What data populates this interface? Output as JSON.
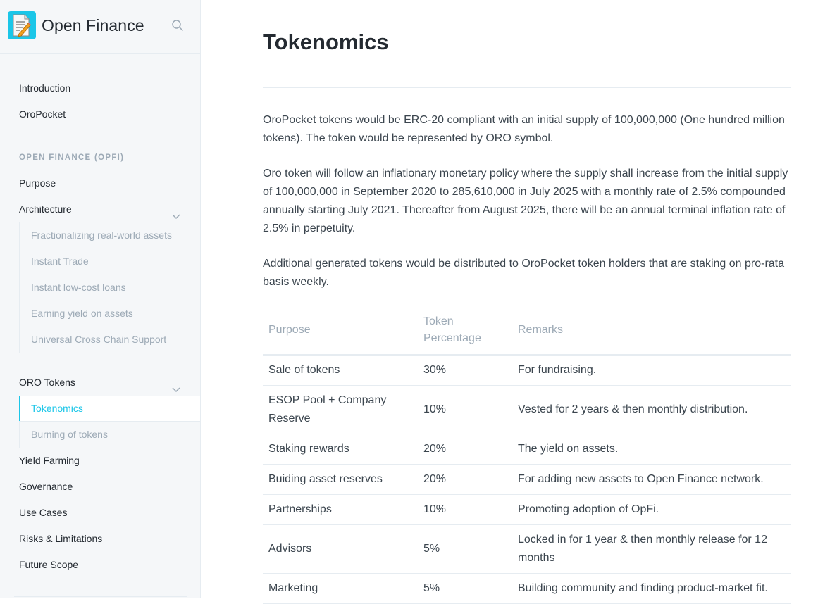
{
  "app": {
    "title": "Open Finance",
    "logo_icon": "memo-pencil-icon",
    "search_icon": "search-icon",
    "accent_color": "#1bc6e8"
  },
  "sidebar": {
    "top_items": [
      {
        "label": "Introduction"
      },
      {
        "label": "OroPocket"
      }
    ],
    "section_title": "OPEN FINANCE (OPFI)",
    "items": [
      {
        "label": "Purpose"
      },
      {
        "label": "Architecture",
        "expanded": true
      },
      {
        "label": "ORO Tokens",
        "expanded": true
      },
      {
        "label": "Yield Farming"
      },
      {
        "label": "Governance"
      },
      {
        "label": "Use Cases"
      },
      {
        "label": "Risks & Limitations"
      },
      {
        "label": "Future Scope"
      }
    ],
    "architecture_children": [
      {
        "label": "Fractionalizing real-world assets"
      },
      {
        "label": "Instant Trade"
      },
      {
        "label": "Instant low-cost loans"
      },
      {
        "label": "Earning yield on assets"
      },
      {
        "label": "Universal Cross Chain Support"
      }
    ],
    "oro_children": [
      {
        "label": "Tokenomics",
        "active": true
      },
      {
        "label": "Burning of tokens"
      }
    ]
  },
  "main": {
    "title": "Tokenomics",
    "paragraphs": [
      "OroPocket tokens would be ERC-20 compliant with an initial supply of 100,000,000 (One hundred million tokens). The token would be represented by ORO symbol.",
      "Oro token will follow an inflationary monetary policy where the supply shall increase from the initial supply of 100,000,000 in September 2020 to 285,610,000 in July 2025 with a monthly rate of 2.5% compounded annually starting July 2021. Thereafter from August 2025, there will be an annual terminal inflation rate of 2.5% in perpetuity.",
      "Additional generated tokens would be distributed to OroPocket token holders that are staking on pro-rata basis weekly."
    ],
    "table": {
      "headers": [
        "Purpose",
        "Token Percentage",
        "Remarks"
      ],
      "rows": [
        [
          "Sale of tokens",
          "30%",
          "For fundraising."
        ],
        [
          "ESOP Pool + Company Reserve",
          "10%",
          "Vested for 2 years & then monthly distribution."
        ],
        [
          "Staking rewards",
          "20%",
          "The yield on assets."
        ],
        [
          "Buiding asset reserves",
          "20%",
          "For adding new assets to Open Finance network."
        ],
        [
          "Partnerships",
          "10%",
          "Promoting adoption of OpFi."
        ],
        [
          "Advisors",
          "5%",
          "Locked in for 1 year & then monthly release for 12 months"
        ],
        [
          "Marketing",
          "5%",
          "Building community and finding product-market fit."
        ]
      ]
    }
  }
}
